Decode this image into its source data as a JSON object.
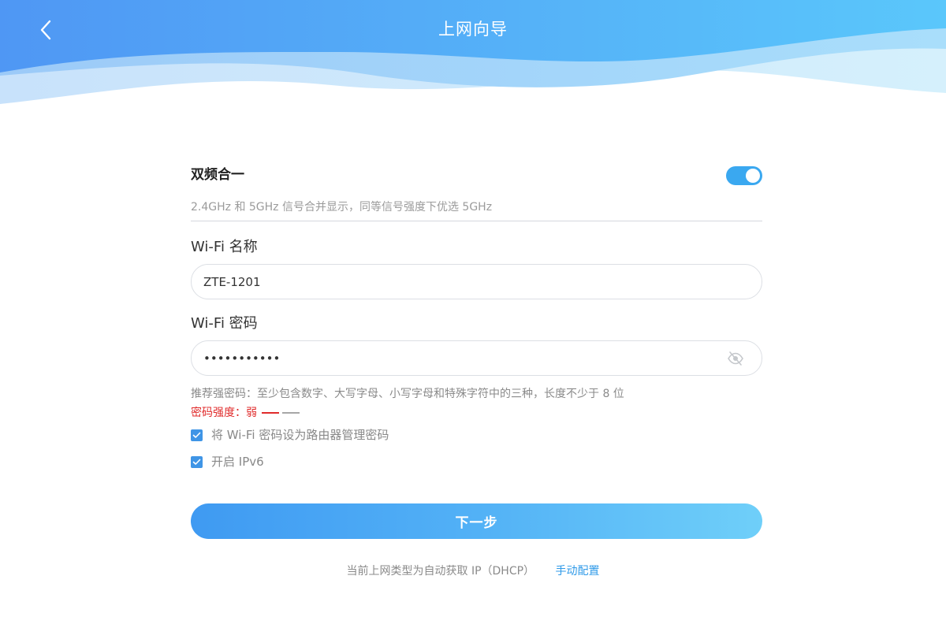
{
  "header": {
    "title": "上网向导",
    "back_icon": "chevron-left-icon"
  },
  "dual_band": {
    "title": "双频合一",
    "description": "2.4GHz 和 5GHz 信号合并显示，同等信号强度下优选 5GHz",
    "enabled": true
  },
  "wifi_name": {
    "label": "Wi-Fi 名称",
    "value": "ZTE-1201"
  },
  "wifi_password": {
    "label": "Wi-Fi 密码",
    "value": "•••••••••••",
    "visibility_icon": "eye-off-icon"
  },
  "password_hint": "推荐强密码：至少包含数字、大写字母、小写字母和特殊字符中的三种，长度不少于 8 位",
  "password_strength": {
    "label": "密码强度：",
    "value": "弱",
    "levels_filled": 1,
    "levels_total": 2
  },
  "options": [
    {
      "label": "将 Wi-Fi 密码设为路由器管理密码",
      "checked": true
    },
    {
      "label": "开启 IPv6",
      "checked": true
    }
  ],
  "next_button": "下一步",
  "footer": {
    "status_text": "当前上网类型为自动获取 IP（DHCP）",
    "manual_link": "手动配置"
  },
  "colors": {
    "accent": "#3aa8f0",
    "weak_strength": "#e02b2b",
    "link": "#2f9ae8"
  }
}
